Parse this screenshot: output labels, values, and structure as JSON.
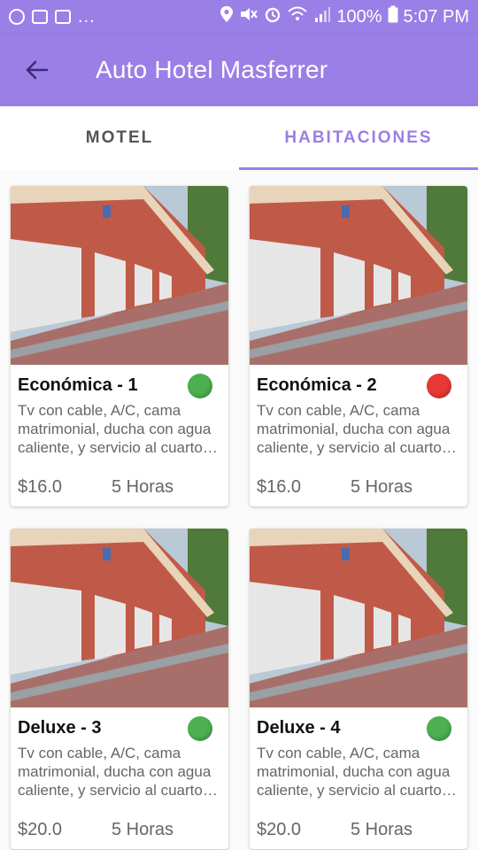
{
  "status_bar": {
    "dots": "...",
    "battery_text": "100%",
    "time": "5:07 PM"
  },
  "app_bar": {
    "title": "Auto Hotel Masferrer"
  },
  "tabs": [
    {
      "label": "MOTEL"
    },
    {
      "label": "HABITACIONES"
    }
  ],
  "rooms": [
    {
      "name": "Económica - 1",
      "desc": "Tv con cable, A/C, cama matrimonial, ducha con agua caliente, y servicio al cuarto…",
      "price": "$16.0",
      "duration": "5 Horas",
      "status_color": "#4caf50"
    },
    {
      "name": "Económica - 2",
      "desc": "Tv con cable, A/C, cama matrimonial, ducha con agua caliente, y servicio al cuarto…",
      "price": "$16.0",
      "duration": "5 Horas",
      "status_color": "#e53935"
    },
    {
      "name": "Deluxe - 3",
      "desc": "Tv con cable, A/C, cama matrimonial, ducha con agua caliente, y servicio al cuarto…",
      "price": "$20.0",
      "duration": "5 Horas",
      "status_color": "#4caf50"
    },
    {
      "name": "Deluxe - 4",
      "desc": "Tv con cable, A/C, cama matrimonial, ducha con agua caliente, y servicio al cuarto…",
      "price": "$20.0",
      "duration": "5 Horas",
      "status_color": "#4caf50"
    }
  ],
  "colors": {
    "primary": "#9a7fe6",
    "available": "#4caf50",
    "occupied": "#e53935"
  }
}
